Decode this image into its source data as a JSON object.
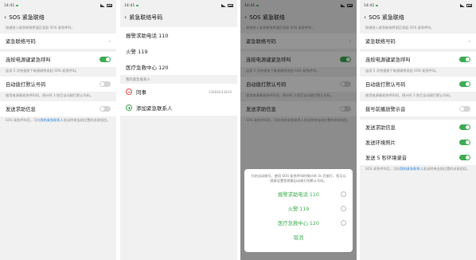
{
  "screen1": {
    "status_time": "14:41",
    "title": "SOS 紧急联络",
    "intro": "按键进入紧急联络界面后发起 SOS 紧急呼叫。",
    "row_contact_number": "紧急联络号码",
    "row_power_key": "连按电源键紧急呼叫",
    "power_key_desc": "连续 5 次快速按下电源键将发起 SOS 紧急呼叫。",
    "row_auto_dial": "自动拨打默认号码",
    "auto_dial_desc": "使用电源键紧急呼叫时，倒计时 3 秒后自动拨打默认号码。",
    "row_send_info": "发送求助信息",
    "bottom_desc_prefix": "SOS 紧急呼叫后，可向",
    "bottom_desc_link": "我的紧急联系人",
    "bottom_desc_suffix": "发送附带当前位置的求助短信。",
    "toggles": {
      "power_key": true,
      "auto_dial": false,
      "send_info": false
    }
  },
  "screen2": {
    "status_time": "14:41",
    "title": "紧急联络号码",
    "numbers": [
      "报警求助电话 110",
      "火警 119",
      "医疗急救中心 120"
    ],
    "section_label": "我的紧急联系人",
    "contact_name": "同事",
    "contact_number": "13666633839",
    "add_contact": "添加紧急联系人"
  },
  "screen3": {
    "status_time": "14:41",
    "title": "SOS 紧急联络",
    "intro": "按键进入紧急联络界面后发起 SOS 紧急呼叫。",
    "row_contact_number": "紧急联络号码",
    "row_power_key": "连按电源键紧急呼叫",
    "power_key_desc": "连续 5 次快速按下电源键将发起 SOS 紧急呼叫。",
    "row_auto_dial": "自动拨打默认号码",
    "auto_dial_desc": "使用电源键紧急呼叫时，倒计时 3 秒后自动拨打默认号码。",
    "row_send_info": "发送求助信息",
    "bottom_desc": "SOS 紧急呼叫后，可向我的紧急联系人发送附带当前位置的求助短信。",
    "sheet_desc": "开启自动拨号，使用 SOS 紧急呼叫时倒计时 3s 后拨打，您可以随意设置您想要自动拨打的默认号码。",
    "options": [
      "报警求助电话 110",
      "火警 119",
      "医疗急救中心 120"
    ],
    "cancel": "取消",
    "toggles": {
      "power_key": true,
      "auto_dial": false,
      "send_info": false
    }
  },
  "screen4": {
    "status_time": "14:42",
    "title": "SOS 紧急联络",
    "intro": "按键进入紧急联络界面后发起 SOS 紧急呼叫。",
    "row_contact_number": "紧急联络号码",
    "row_power_key": "连按电源键紧急呼叫",
    "power_key_desc": "连续 5 次快速按下电源键将发起 SOS 紧急呼叫。",
    "row_auto_dial": "自动拨打默认号码",
    "auto_dial_desc": "使用电源键紧急呼叫时，倒计时 3 秒后自动拨打默认号码。",
    "row_ring": "拨号前播放警示音",
    "row_send_info": "发送求助信息",
    "row_send_photo": "发送环境照片",
    "row_send_audio": "发送 5 秒环境录音",
    "bottom_desc_prefix": "SOS 紧急呼叫后，可向",
    "bottom_desc_link": "我的紧急联系人",
    "bottom_desc_suffix": "发送附带当前位置的求助短信。",
    "toggles": {
      "power_key": true,
      "auto_dial": true,
      "ring": false,
      "send_info": true,
      "send_photo": true,
      "send_audio": true
    }
  },
  "colors": {
    "accent_green": "#3cab51",
    "link_blue": "#1e7fd6",
    "danger_red": "#e24a4a"
  }
}
